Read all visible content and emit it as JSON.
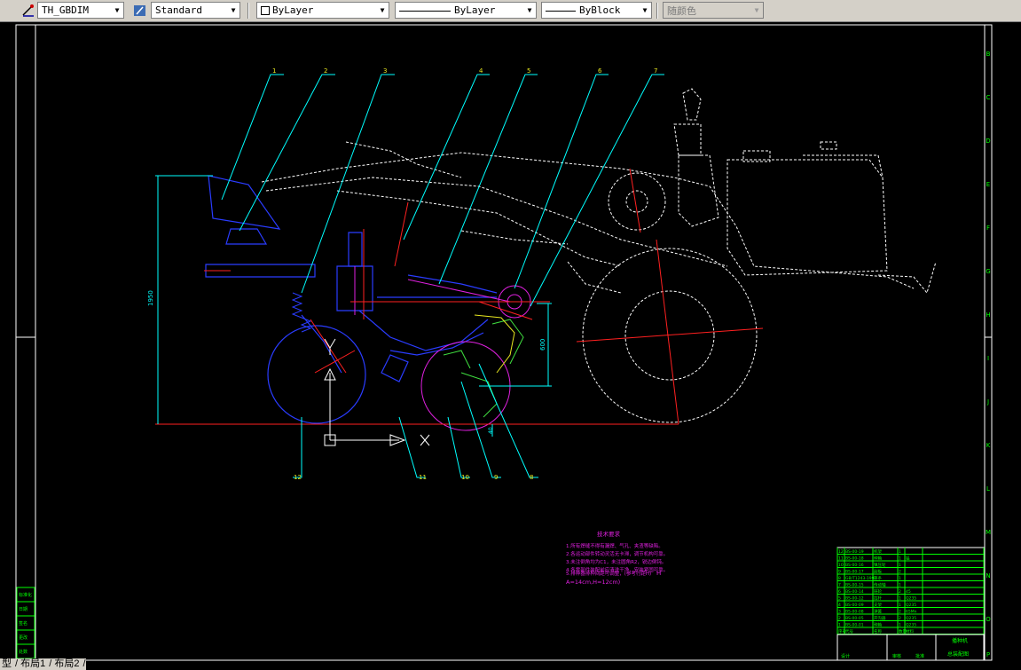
{
  "toolbar": {
    "dimstyle": "TH_GBDIM",
    "textstyle": "Standard",
    "layer": "ByLayer",
    "linetype": "ByLayer",
    "lineweight": "ByBlock",
    "plotstyle": "随颜色"
  },
  "drawing": {
    "balloons": [
      "1",
      "2",
      "3",
      "4",
      "5",
      "6",
      "7",
      "12",
      "11",
      "10",
      "9",
      "8"
    ],
    "dim_overall": "1950",
    "dim_side": "600",
    "dim_small": "40",
    "right_ruler": [
      "B",
      "C",
      "D",
      "E",
      "F",
      "G",
      "H",
      "I",
      "J",
      "K",
      "L",
      "M",
      "N",
      "O",
      "P"
    ],
    "left_ruler": [
      "标准化",
      "日期",
      "签名",
      "更改",
      "处数"
    ]
  },
  "notes": {
    "heading": "技术要求",
    "lines": [
      "1.所有焊缝不得有漏焊、气孔、夹渣等缺陷。",
      "2.各运动部件转动灵活无卡滞，调节机构可靠。",
      "3.未注倒角均为C1，未注圆角R2，锐边倒钝。",
      "4.各零部件装配前应清洗干净，安装紧固可靠。",
      "5.排种器排种间距可调整，(参考行距H)"
    ],
    "marker": "H",
    "formula": "A=14cm,H=12cm)"
  },
  "title_block": {
    "rows": [
      [
        "12",
        "BS-00-19",
        "机架",
        "1",
        ""
      ],
      [
        "11",
        "BS-00-18",
        "种箱",
        "1",
        "铝"
      ],
      [
        "10",
        "BS-00-16",
        "镇压轮",
        "1",
        ""
      ],
      [
        "9",
        "BS-00-17",
        "刮板",
        "2",
        ""
      ],
      [
        "8",
        "GB/T1243-1997",
        "链条",
        "1",
        ""
      ],
      [
        "7",
        "BS-00-15",
        "传动轴",
        "1",
        ""
      ],
      [
        "6",
        "BS-00-14",
        "链轮",
        "2",
        "45"
      ],
      [
        "5",
        "BS-00-12",
        "拉杆",
        "1",
        "Q235"
      ],
      [
        "4",
        "BS-00-09",
        "支架",
        "1",
        "Q235"
      ],
      [
        "3",
        "BS-00-08",
        "弹簧",
        "2",
        "65Mn"
      ],
      [
        "2",
        "BS-00-05",
        "开沟器",
        "2",
        "Q235"
      ],
      [
        "1",
        "BS-00-01",
        "种箱",
        "1",
        "Q235"
      ]
    ],
    "header": [
      "序号",
      "代号",
      "名称",
      "数量",
      "材料"
    ],
    "assembly_name": "播种机",
    "subtitle": "总装配图",
    "bottom": [
      "设计",
      "审核",
      "批准"
    ]
  },
  "tabs": [
    "型",
    "布局1",
    "布局2"
  ]
}
